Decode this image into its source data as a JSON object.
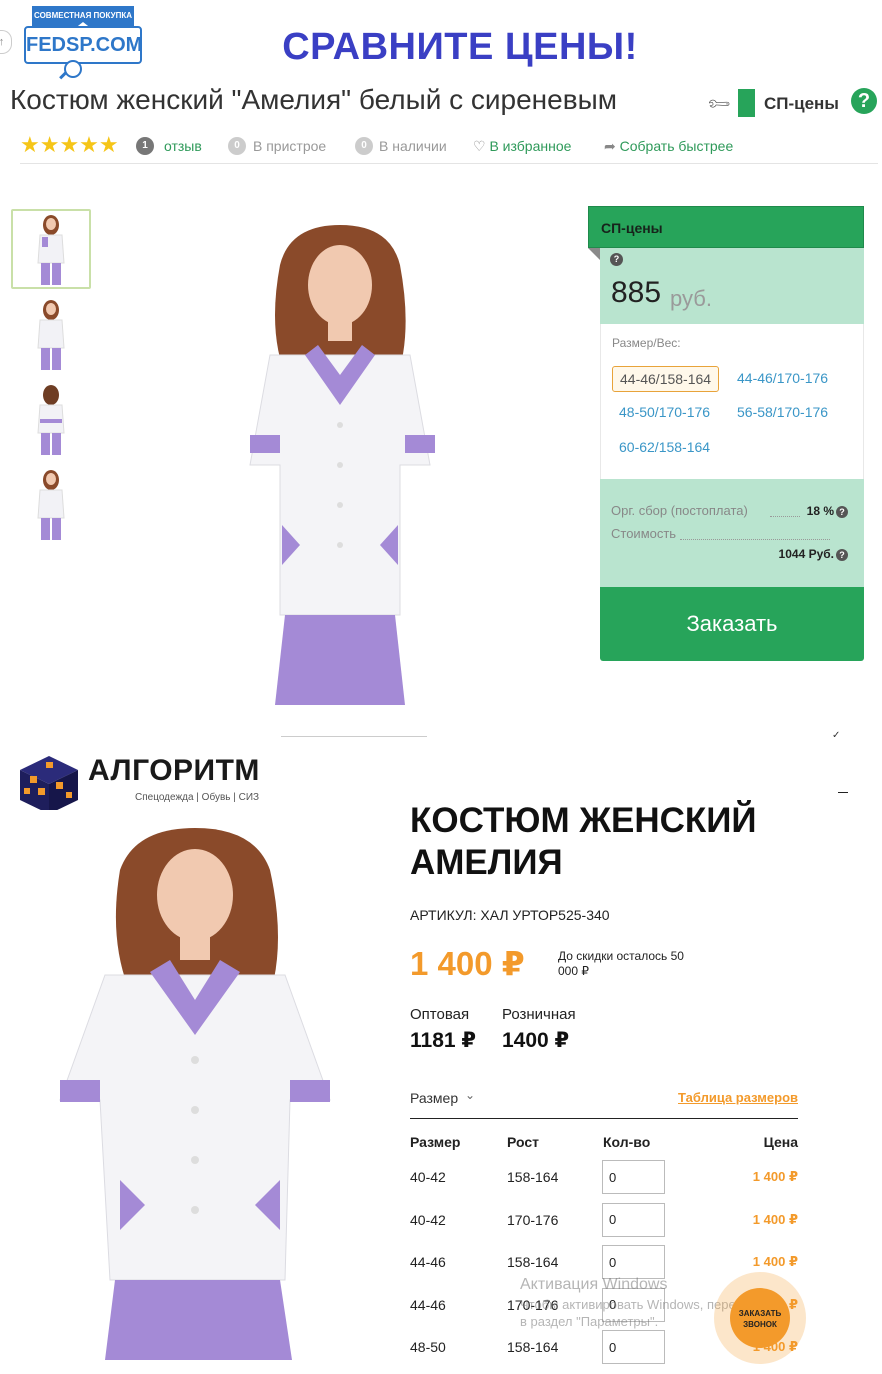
{
  "fedsp": {
    "logo_banner": "СОВМЕСТНАЯ ПОКУПКА",
    "logo_text": "FEDSP.COM",
    "slogan": "СРАВНИТЕ ЦЕНЫ!",
    "product_title": "Костюм женский \"Амелия\" белый с сиреневым",
    "sp_label": "СП-цены",
    "rating_stars": 5,
    "reviews_count": "1",
    "reviews_label": "отзыв",
    "pristroy_count": "0",
    "pristroy_label": "В пристрое",
    "stock_count": "0",
    "stock_label": "В наличии",
    "favorite_label": "В избранное",
    "collect_label": "Собрать быстрее",
    "thumbnails_count": 4,
    "price_panel": {
      "header": "СП-цены",
      "price": "885",
      "currency": "руб.",
      "size_label": "Размер/Вес:",
      "sizes": [
        "44-46/158-164",
        "44-46/170-176",
        "48-50/170-176",
        "56-58/170-176",
        "60-62/158-164"
      ],
      "selected_size": "44-46/158-164",
      "org_fee_label": "Орг. сбор (постоплата)",
      "org_fee_value": "18 %",
      "cost_label": "Стоимость",
      "cost_value": "1044 Руб.",
      "order_button": "Заказать"
    },
    "colors": {
      "green": "#27a45a",
      "mint": "#b9e4cf",
      "blue": "#2e77c9",
      "slogan": "#3a3fc4"
    }
  },
  "algoritm": {
    "brand": "АЛГОРИТМ",
    "tagline": "Спецодежда | Обувь | СИЗ",
    "title": "КОСТЮМ ЖЕНСКИЙ АМЕЛИЯ",
    "sku": "АРТИКУЛ: ХАЛ УРТОР525-340",
    "price": "1 400 ₽",
    "discount_note": "До скидки осталось 50 000 ₽",
    "wholesale_label": "Оптовая",
    "wholesale_value": "1181 ₽",
    "retail_label": "Розничная",
    "retail_value": "1400 ₽",
    "size_dropdown": "Размер",
    "size_table_link": "Таблица размеров",
    "table": {
      "headers": [
        "Размер",
        "Рост",
        "Кол-во",
        "Цена"
      ],
      "rows": [
        {
          "size": "40-42",
          "height": "158-164",
          "qty": "0",
          "price": "1 400 ₽"
        },
        {
          "size": "40-42",
          "height": "170-176",
          "qty": "0",
          "price": "1 400 ₽"
        },
        {
          "size": "44-46",
          "height": "158-164",
          "qty": "0",
          "price": "1 400 ₽"
        },
        {
          "size": "44-46",
          "height": "170-176",
          "qty": "0",
          "price": "1 400 ₽"
        },
        {
          "size": "48-50",
          "height": "158-164",
          "qty": "0",
          "price": "1 400 ₽"
        }
      ]
    },
    "callback_button": "ЗАКАЗАТЬ ЗВОНОК",
    "colors": {
      "accent": "#f39a2b"
    }
  },
  "windows_activation": {
    "title": "Активация Windows",
    "text": "Чтобы активировать Windows, перейдите в раздел \"Параметры\"."
  }
}
